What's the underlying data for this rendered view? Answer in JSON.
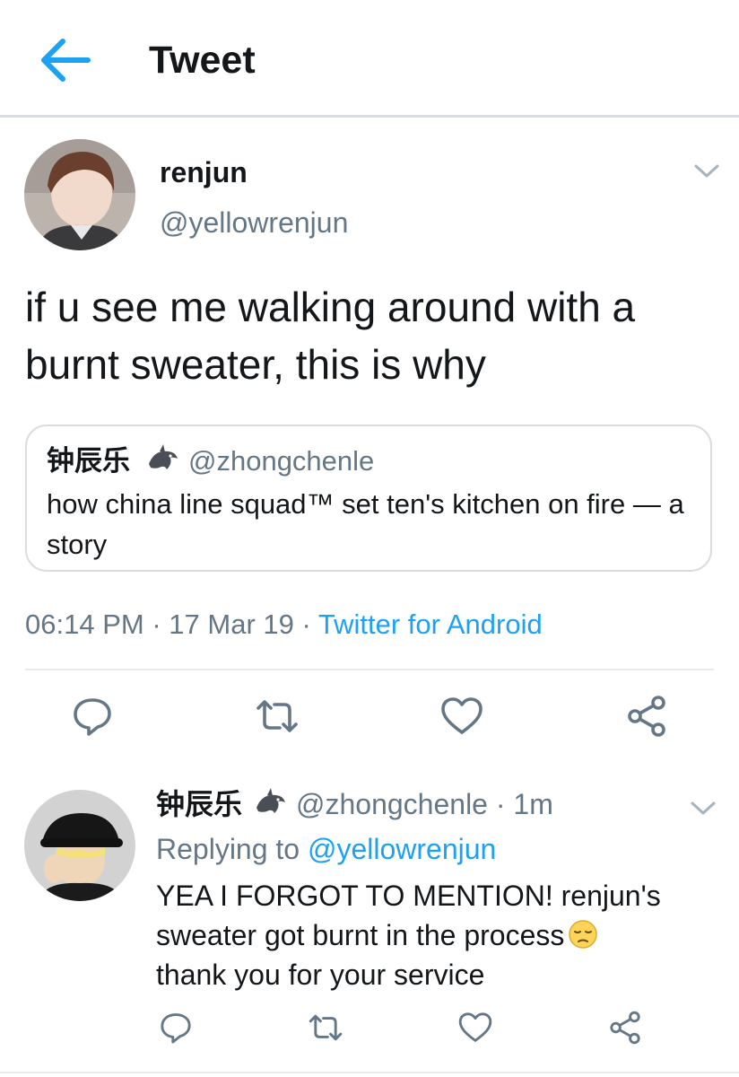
{
  "header": {
    "title": "Tweet",
    "back_icon": "arrow-left-icon"
  },
  "tweet": {
    "author_name": "renjun",
    "author_handle": "@yellowrenjun",
    "text": "if u see me walking around with a burnt sweater, this is why",
    "quote": {
      "name": "钟辰乐",
      "badge_icon": "dolphin-emoji-icon",
      "handle": "@zhongchenle",
      "text": "how china line squad™ set ten's kitchen on fire — a story"
    },
    "time": "06:14 PM",
    "date": "17 Mar 19",
    "separator": "·",
    "source": "Twitter for Android",
    "actions": [
      "reply-icon",
      "retweet-icon",
      "like-icon",
      "share-icon"
    ]
  },
  "reply": {
    "author_name": "钟辰乐",
    "badge_icon": "dolphin-emoji-icon",
    "handle_time": "@zhongchenle · 1m",
    "replying_prefix": "Replying to ",
    "replying_handle": "@yellowrenjun",
    "text_line1": "YEA I FORGOT TO MENTION! renjun's",
    "text_line2": "sweater got burnt in the process",
    "text_emoji": "pensive-face-emoji-icon",
    "text_line3": "thank you for your service",
    "actions": [
      "reply-icon",
      "retweet-icon",
      "like-icon",
      "share-icon"
    ]
  },
  "colors": {
    "accent": "#1da1f2",
    "secondary_text": "#657786",
    "text": "#14171a",
    "border": "#d9dde1"
  }
}
